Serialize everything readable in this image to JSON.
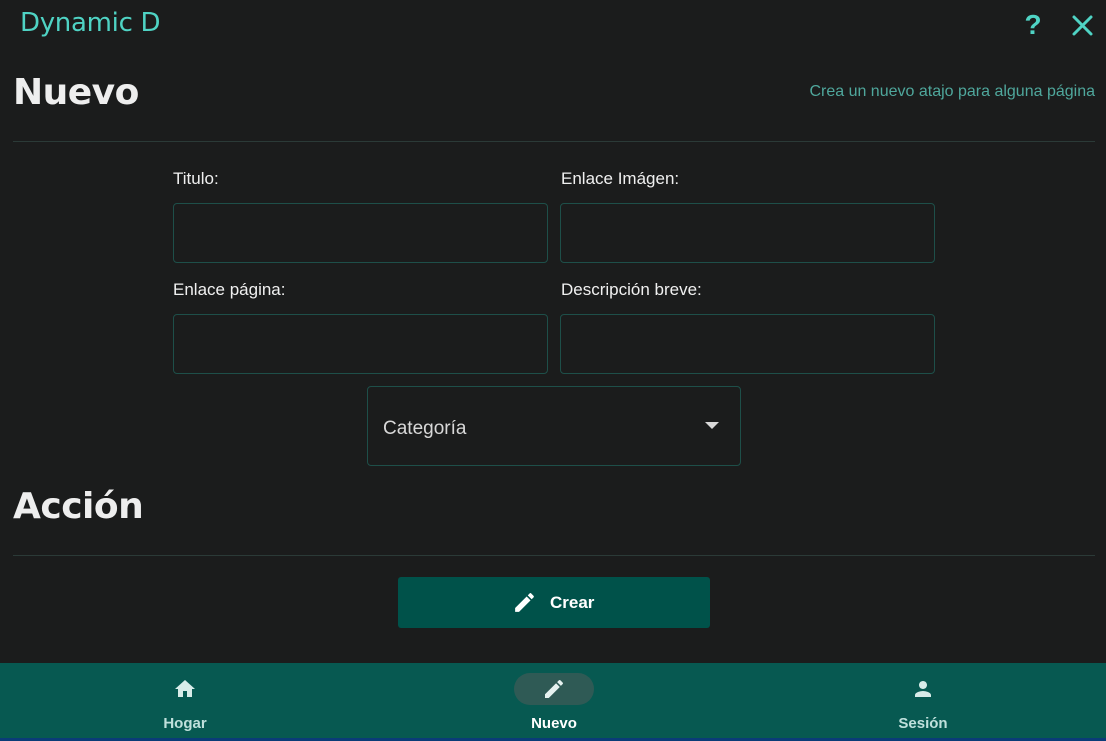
{
  "window": {
    "title": "Dynamic D",
    "help_label": "?"
  },
  "new_section": {
    "heading": "Nuevo",
    "subtitle": "Crea un nuevo atajo para alguna página"
  },
  "form": {
    "title_label": "Titulo:",
    "title_value": "",
    "image_link_label": "Enlace Imágen:",
    "image_link_value": "",
    "page_link_label": "Enlace página:",
    "page_link_value": "",
    "description_label": "Descripción breve:",
    "description_value": "",
    "category_label": "Categoría"
  },
  "action_section": {
    "heading": "Acción",
    "create_label": "Crear"
  },
  "bottom_nav": {
    "items": [
      {
        "label": "Hogar",
        "icon": "home-icon",
        "active": false
      },
      {
        "label": "Nuevo",
        "icon": "pencil-icon",
        "active": true
      },
      {
        "label": "Sesión",
        "icon": "person-icon",
        "active": false
      }
    ]
  },
  "colors": {
    "accent": "#4fd3c4",
    "background": "#1b1c1c",
    "nav_bar": "#075951",
    "button": "#00524a"
  }
}
